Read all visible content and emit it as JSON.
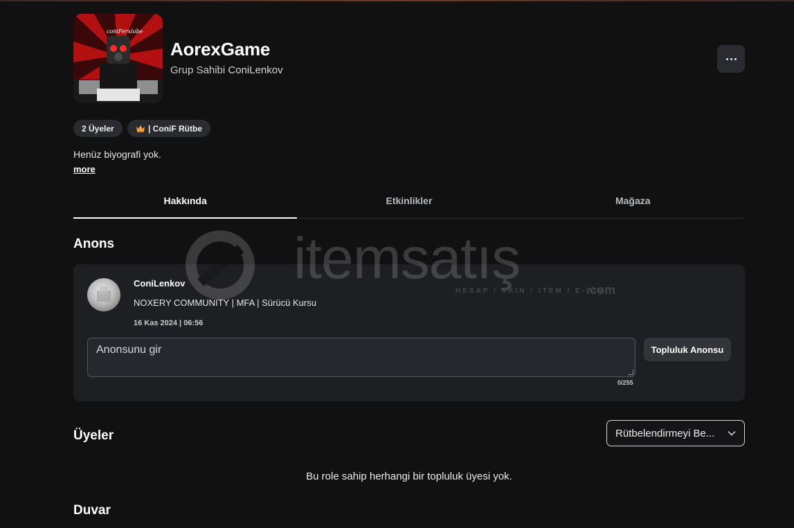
{
  "group": {
    "name": "AorexGame",
    "owner_prefix": "Grup Sahibi",
    "owner_name": "ConiLenkov",
    "avatar_label": "coniFerxlobe",
    "member_chip": "2 Üyeler",
    "rank_chip": "| ConiF Rütbe",
    "bio": "Henüz biyografi yok.",
    "more_label": "more"
  },
  "tabs": [
    {
      "label": "Hakkında",
      "active": true
    },
    {
      "label": "Etkinlikler",
      "active": false
    },
    {
      "label": "Mağaza",
      "active": false
    }
  ],
  "announcement": {
    "section_title": "Anons",
    "author": "ConiLenkov",
    "text": "NOXERY COMMUNITY | MFA | Sürücü Kursu",
    "date": "16 Kas 2024 | 06:56",
    "input_placeholder": "Anonsunu gir",
    "char_count": "0/255",
    "button_label": "Topluluk Anonsu"
  },
  "members": {
    "section_title": "Üyeler",
    "rank_select_value": "Rütbelendirmeyi Be...",
    "empty_text": "Bu role sahip herhangi bir topluluk üyesi yok."
  },
  "wall": {
    "section_title": "Duvar"
  },
  "watermark": {
    "brand": "itemsatış",
    "tagline": "HESAP / SKIN / ITEM / E-PIN",
    "domain": ".com"
  },
  "colors": {
    "background": "#111112",
    "card": "#1e1f23",
    "chip": "#2a2b30",
    "text": "#f2f2f3"
  }
}
